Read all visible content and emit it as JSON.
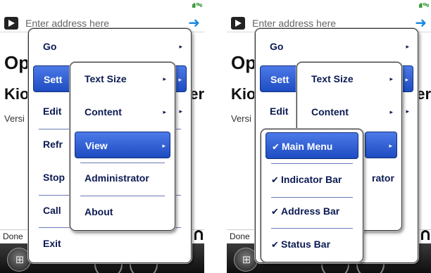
{
  "screens": [
    {
      "signal": "ıll ⁰¹ᵍ",
      "address": {
        "placeholder": "Enter address here"
      },
      "page": {
        "title_partial": "Op",
        "subtitle_partial": "Kio",
        "subtitle_tail": "er",
        "version_partial": "Versi"
      },
      "status": {
        "text": "Done"
      },
      "main_menu": {
        "items": [
          {
            "label": "Go",
            "arrow": "▸"
          },
          {
            "label": "Sett",
            "arrow": "▸"
          },
          {
            "label": "Edit",
            "arrow": "▸"
          },
          {
            "label": "Refr"
          },
          {
            "label": "Stop"
          },
          {
            "label": "Call"
          },
          {
            "label": "Exit"
          }
        ]
      },
      "settings_menu": {
        "items": [
          {
            "label": "Text Size",
            "arrow": "▸"
          },
          {
            "label": "Content",
            "arrow": "▸"
          },
          {
            "label": "View",
            "arrow": "▸"
          },
          {
            "label": "Administrator"
          },
          {
            "label": "About"
          }
        ]
      }
    },
    {
      "signal": "ıll ⁰¹ᵍ",
      "address": {
        "placeholder": "Enter address here"
      },
      "page": {
        "title_partial": "Op",
        "subtitle_partial": "Kio",
        "subtitle_tail": "er",
        "version_partial": "Versi"
      },
      "status": {
        "text": "Done"
      },
      "main_menu": {
        "items": [
          {
            "label": "Go",
            "arrow": "▸"
          },
          {
            "label": "Sett",
            "arrow": "▸"
          },
          {
            "label": "Edit",
            "arrow": "▸"
          }
        ]
      },
      "settings_menu": {
        "items": [
          {
            "label": "Text Size",
            "arrow": "▸"
          },
          {
            "label": "Content",
            "arrow": "▸"
          },
          {
            "label": "rator"
          }
        ]
      },
      "view_menu": {
        "check_mark": "✔",
        "items": [
          {
            "label": "Main Menu",
            "checked": true
          },
          {
            "label": "Indicator Bar",
            "checked": true
          },
          {
            "label": "Address Bar",
            "checked": true
          },
          {
            "label": "Status Bar",
            "checked": true
          }
        ]
      }
    }
  ],
  "colors": {
    "menu_text": "#0b1a52",
    "highlight": "#2c5ad6",
    "address_arrow": "#1e88e5"
  },
  "icons": {
    "address_icon": "address-bar-icon",
    "go": "go-arrow-icon",
    "start": "windows-start-icon",
    "lock": "lock-icon"
  }
}
